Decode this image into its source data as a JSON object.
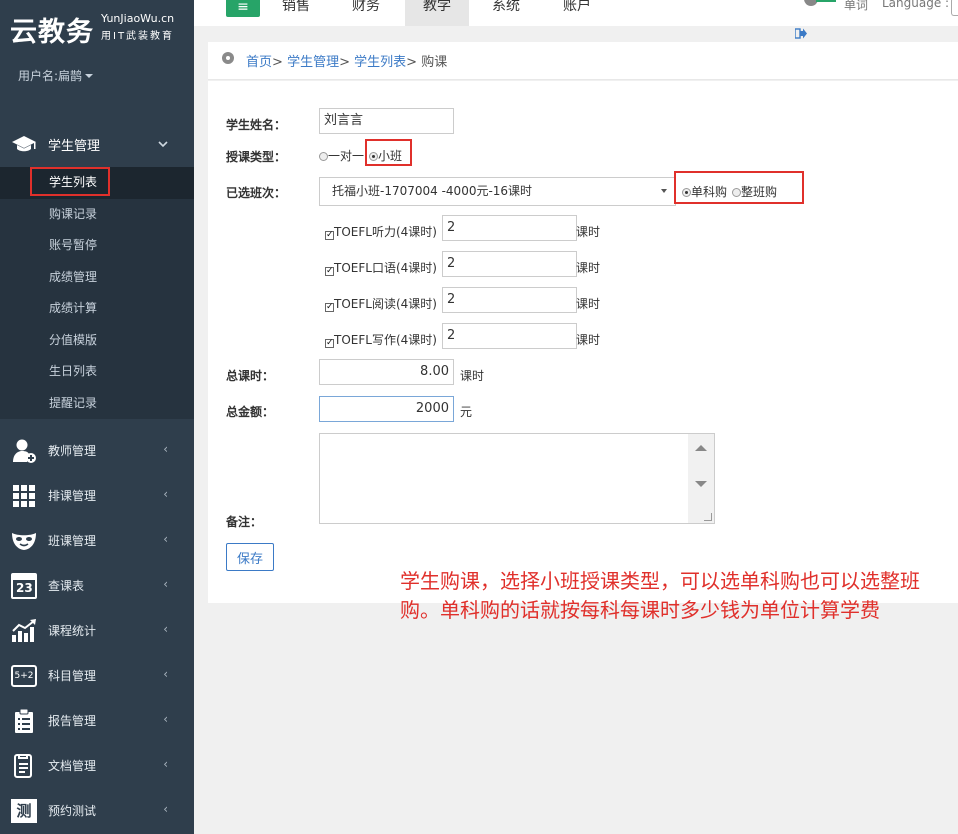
{
  "app": {
    "logo_main": "云教务",
    "logo_domain": "YunJiaoWu.cn",
    "logo_slogan": "用IT武装教育"
  },
  "user": {
    "label": "用户名:扁鹊"
  },
  "sidebar": {
    "open_group": {
      "label": "学生管理",
      "icon": "graduation-cap-icon",
      "items": [
        "学生列表",
        "购课记录",
        "账号暂停",
        "成绩管理",
        "成绩计算",
        "分值模版",
        "生日列表",
        "提醒记录"
      ],
      "active_index": 0
    },
    "groups": [
      {
        "label": "教师管理",
        "icon": "teacher-icon"
      },
      {
        "label": "排课管理",
        "icon": "grid-icon"
      },
      {
        "label": "班课管理",
        "icon": "mask-icon"
      },
      {
        "label": "查课表",
        "icon": "calendar-icon",
        "icon_text": "23"
      },
      {
        "label": "课程统计",
        "icon": "chart-icon"
      },
      {
        "label": "科目管理",
        "icon": "blackboard-icon",
        "icon_text": "5+2"
      },
      {
        "label": "报告管理",
        "icon": "clipboard-icon"
      },
      {
        "label": "文档管理",
        "icon": "document-icon"
      },
      {
        "label": "预约测试",
        "icon": "test-icon",
        "icon_text": "测"
      }
    ],
    "arrow_collapsed": "‹",
    "arrow_open": "⌄"
  },
  "topbar": {
    "menu_icon": "≡",
    "tabs": [
      "销售",
      "财务",
      "教学",
      "系统",
      "账户"
    ],
    "active_tab": 2,
    "right_text_1": "单词",
    "right_text_2": "Language :",
    "logout_icon": "logout-icon"
  },
  "breadcrumb": {
    "home": "首页",
    "level1": "学生管理",
    "level2": "学生列表",
    "current": "购课",
    "sep": ">"
  },
  "form": {
    "student_name_label": "学生姓名：",
    "student_name_value": "刘言言",
    "type_label": "授课类型：",
    "type_options": [
      "一对一",
      "小班"
    ],
    "type_selected": 1,
    "class_label": "已选班次：",
    "class_value": "托福小班-1707004 -4000元-16课时",
    "buy_options": [
      "单科购",
      "整班购"
    ],
    "buy_selected": 0,
    "subjects": [
      {
        "name": "TOEFL听力(4课时)",
        "hours": "2"
      },
      {
        "name": "TOEFL口语(4课时)",
        "hours": "2"
      },
      {
        "name": "TOEFL阅读(4课时)",
        "hours": "2"
      },
      {
        "name": "TOEFL写作(4课时)",
        "hours": "2"
      }
    ],
    "hours_unit": "课时",
    "total_hours_label": "总课时：",
    "total_hours_value": "8.00",
    "total_amount_label": "总金额：",
    "total_amount_value": "2000",
    "amount_unit": "元",
    "remark_label": "备注：",
    "save_label": "保存"
  },
  "annotation": {
    "text": "学生购课，选择小班授课类型，可以选单科购也可以选整班购。单科购的话就按每科每课时多少钱为单位计算学费"
  },
  "colors": {
    "sidebar_bg": "#2f3e4c",
    "accent_green": "#27a468",
    "link_blue": "#3b7ac6",
    "highlight_red": "#e0302b"
  }
}
